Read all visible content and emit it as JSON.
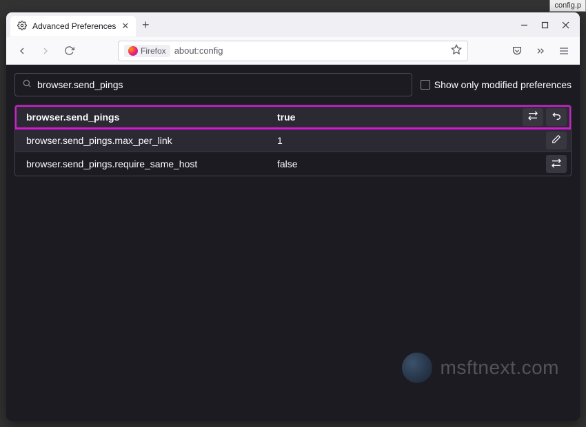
{
  "file_tab": "config.p",
  "tab": {
    "title": "Advanced Preferences"
  },
  "urlbar": {
    "identity": "Firefox",
    "url": "about:config"
  },
  "search": {
    "value": "browser.send_pings"
  },
  "show_only_modified_label": "Show only modified preferences",
  "prefs": [
    {
      "name": "browser.send_pings",
      "value": "true",
      "highlight": true,
      "actions": [
        "toggle",
        "reset"
      ]
    },
    {
      "name": "browser.send_pings.max_per_link",
      "value": "1",
      "highlight": false,
      "actions": [
        "edit"
      ]
    },
    {
      "name": "browser.send_pings.require_same_host",
      "value": "false",
      "highlight": false,
      "actions": [
        "toggle"
      ]
    }
  ],
  "watermark": "msftnext.com"
}
